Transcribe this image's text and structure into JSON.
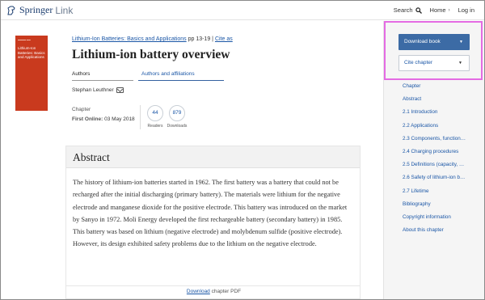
{
  "header": {
    "logo_springer": "Springer",
    "logo_link": "Link",
    "nav": {
      "search": "Search",
      "home": "Home",
      "login": "Log in"
    }
  },
  "book": {
    "cover_title": "Lithium-Ion Batteries: Basics and Applications",
    "link_title": "Lithium-Ion Batteries: Basics and Applications",
    "pages": " pp 13-19 | ",
    "cite_as": "Cite as"
  },
  "chapter": {
    "title": "Lithium-ion battery overview",
    "tabs": [
      "Authors",
      "Authors and affiliations"
    ],
    "author": "Stephan Leuthner",
    "type": "Chapter",
    "first_online_label": "First Online:",
    "first_online_date": " 03 May 2018",
    "metrics": {
      "readers_value": "44",
      "readers_label": "Readers",
      "downloads_value": "879",
      "downloads_label": "Downloads"
    }
  },
  "abstract": {
    "heading": "Abstract",
    "text": "The history of lithium-ion batteries started in 1962. The first battery was a battery that could not be recharged after the initial discharging (primary battery). The materials were lithium for the negative electrode and manganese dioxide for the positive electrode. This battery was introduced on the market by Sanyo in 1972. Moli Energy developed the first rechargeable battery (secondary battery) in 1985. This battery was based on lithium (negative electrode) and molybdenum sulfide (positive electrode). However, its design exhibited safety problems due to the lithium on the negative electrode.",
    "download_link": "Download",
    "download_suffix": " chapter PDF"
  },
  "sidebar": {
    "download_button": "Download book",
    "cite_button": "Cite chapter",
    "toc": [
      "Chapter",
      "Abstract",
      "2.1 Introduction",
      "2.2 Applications",
      "2.3 Components, function…",
      "2.4 Charging procedures",
      "2.5 Definitions (capacity, …",
      "2.6 Safety of lithium-ion b…",
      "2.7 Lifetime",
      "Bibliography",
      "Copyright information",
      "About this chapter"
    ]
  },
  "colors": {
    "accent": "#3c6ba5",
    "link": "#1a56a6",
    "cover": "#c93a1e",
    "highlight": "#e46be3"
  }
}
